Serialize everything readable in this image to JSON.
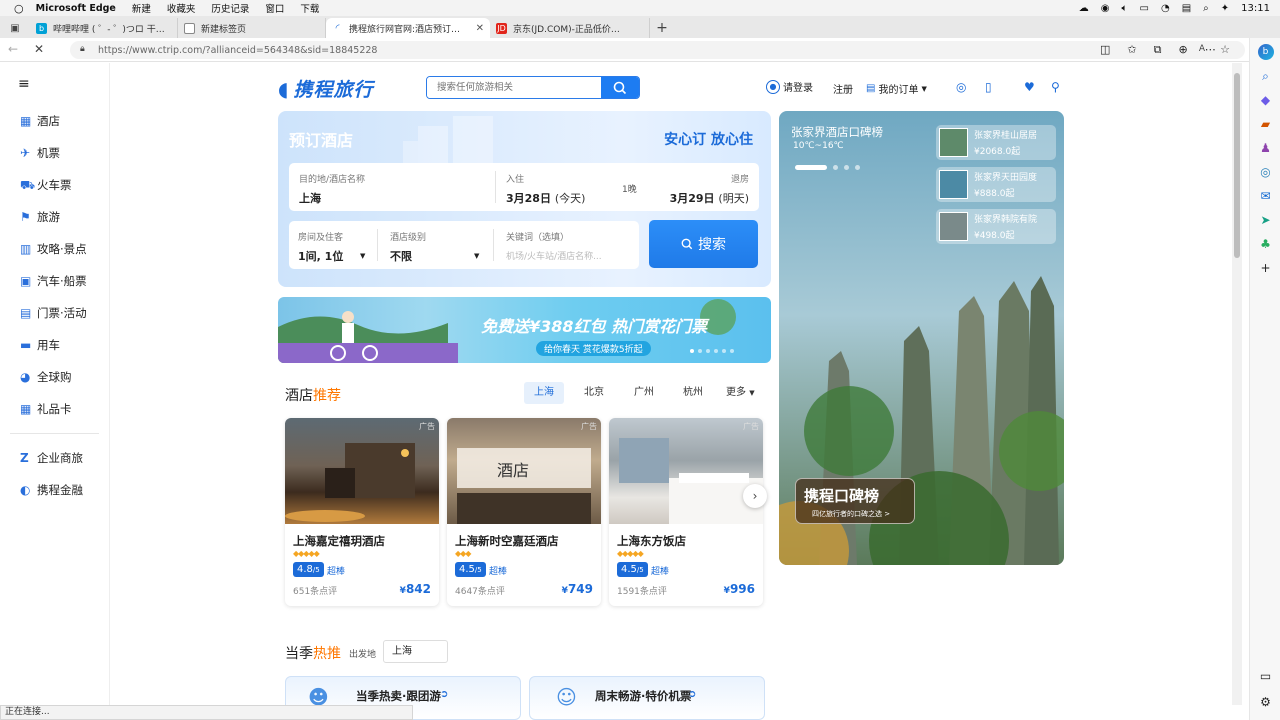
{
  "menubar": {
    "app": "Microsoft Edge",
    "menus": [
      "新建",
      "收藏夹",
      "历史记录",
      "窗口",
      "下载"
    ],
    "time": "13:11"
  },
  "tabs": [
    {
      "title": "哔哩哔哩 ( ゜- ゜)つロ 干杯~-bilibili",
      "color": "#00a1d6"
    },
    {
      "title": "新建标签页",
      "color": "#888888"
    },
    {
      "title": "携程旅行网官网:酒店预订,机票预订查询",
      "color": "#1c6bd8",
      "active": true
    },
    {
      "title": "京东(JD.COM)-正品低价、品质保障",
      "color": "#e1251b"
    }
  ],
  "address": {
    "url": "https://www.ctrip.com/?allianceid=564348&sid=18845228"
  },
  "leftnav": {
    "items": [
      "酒店",
      "机票",
      "火车票",
      "旅游",
      "攻略·景点",
      "汽车·船票",
      "门票·活动",
      "用车",
      "全球购",
      "礼品卡"
    ],
    "items2": [
      "企业商旅",
      "携程金融"
    ]
  },
  "header": {
    "logo": "携程旅行",
    "search_placeholder": "搜索任何旅游相关",
    "login": "请登录",
    "register": "注册",
    "orders": "我的订单"
  },
  "booking": {
    "title": "预订酒店",
    "slogan": "安心订 放心住",
    "dest_label": "目的地/酒店名称",
    "dest_value": "上海",
    "checkin_label": "入住",
    "checkin_value": "3月28日",
    "checkin_note": "(今天)",
    "nights": "1晚",
    "checkout_label": "退房",
    "checkout_value": "3月29日",
    "checkout_note": "(明天)",
    "room_label": "房间及住客",
    "room_value": "1间, 1位",
    "level_label": "酒店级别",
    "level_value": "不限",
    "keyword_label": "关键词（选填）",
    "keyword_placeholder": "机场/火车站/酒店名称...",
    "search_btn": "搜索"
  },
  "banner": {
    "main": "免费送¥388红包 热门赏花门票",
    "sub": "给你春天 赏花爆款5折起"
  },
  "recommend": {
    "title_a": "酒店",
    "title_b": "推荐",
    "cities": [
      "上海",
      "北京",
      "广州",
      "杭州",
      "更多"
    ],
    "hotels": [
      {
        "name": "上海嘉定禧玥酒店",
        "stars": "◆◆◆◆◆",
        "score": "4.8",
        "score_max": "/5",
        "level": "超棒",
        "reviews": "651条点评",
        "price": "842",
        "ad": "广告"
      },
      {
        "name": "上海新时空嘉廷酒店",
        "stars": "◆◆◆",
        "score": "4.5",
        "score_max": "/5",
        "level": "超棒",
        "reviews": "4647条点评",
        "price": "749",
        "ad": "广告"
      },
      {
        "name": "上海东方饭店",
        "stars": "◆◆◆◆◆",
        "score": "4.5",
        "score_max": "/5",
        "level": "超棒",
        "reviews": "1591条点评",
        "price": "996",
        "ad": "广告"
      }
    ],
    "currency": "¥"
  },
  "season": {
    "title_a": "当季",
    "title_b": "热推",
    "depart_label": "出发地",
    "depart_value": "上海",
    "cards": [
      "当季热卖·跟团游",
      "周末畅游·特价机票"
    ]
  },
  "sidead": {
    "title": "张家界酒店口碑榜",
    "temp": "10℃~16℃",
    "hotels": [
      {
        "name": "张家界桂山居居",
        "price": "¥2068.0起"
      },
      {
        "name": "张家界天田园度",
        "price": "¥888.0起"
      },
      {
        "name": "张家界韩院有院",
        "price": "¥498.0起"
      }
    ],
    "badge": "携程口碑榜",
    "badge_sub": "四亿旅行者的口碑之选 >"
  },
  "statusbar": "正在连接..."
}
